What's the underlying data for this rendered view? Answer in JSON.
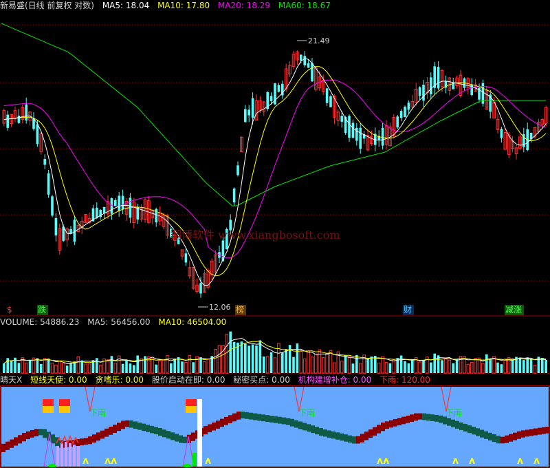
{
  "kline_header": {
    "title": "新易盛(日线 前复权 对数)",
    "ma5": "MA5: 18.04",
    "ma10": "MA10: 17.80",
    "ma20": "MA20: 18.29",
    "ma60": "MA60: 18.67"
  },
  "kline_annotations": {
    "high_price": "21.49",
    "low_price": "12.06",
    "watermark": "翔博软件 www.xiangbosoft.com"
  },
  "signal_labels": [
    "$",
    "跌",
    "榜",
    "财",
    "减涨"
  ],
  "volume_header": {
    "volume": "VOLUME: 54886.23",
    "ma5": "MA5: 56456.00",
    "ma10": "MA10: 46504.00"
  },
  "indicator_header": {
    "name": "晴天X",
    "angel": "短线天使: 0.00",
    "greed": "贪嗜乐: 0.00",
    "launch": "股价启动在即: 0.00",
    "secret_buy": "秘密买点: 0.00",
    "build": "机构建增补仓: 0.00",
    "rain": "下雨: 120.00"
  },
  "indicator_labels": {
    "rain_marks": [
      "下雨",
      "下雨",
      "下雨"
    ],
    "up_marks": [
      "ʌ",
      "ʌʌ",
      "ʌ",
      "ʌʌ",
      "ʌ",
      "ʌ",
      "ʌ",
      "ʌ"
    ]
  },
  "colors": {
    "up": "#ff3232",
    "down": "#54fcfc",
    "ma5": "#ffffff",
    "ma10": "#ffff00",
    "ma20": "#ff00ff",
    "ma60": "#00e600",
    "grid": "#a00000",
    "sky": "#66a8ff",
    "cloud_up": "#8b0000",
    "cloud_down": "#0f5a46"
  }
}
